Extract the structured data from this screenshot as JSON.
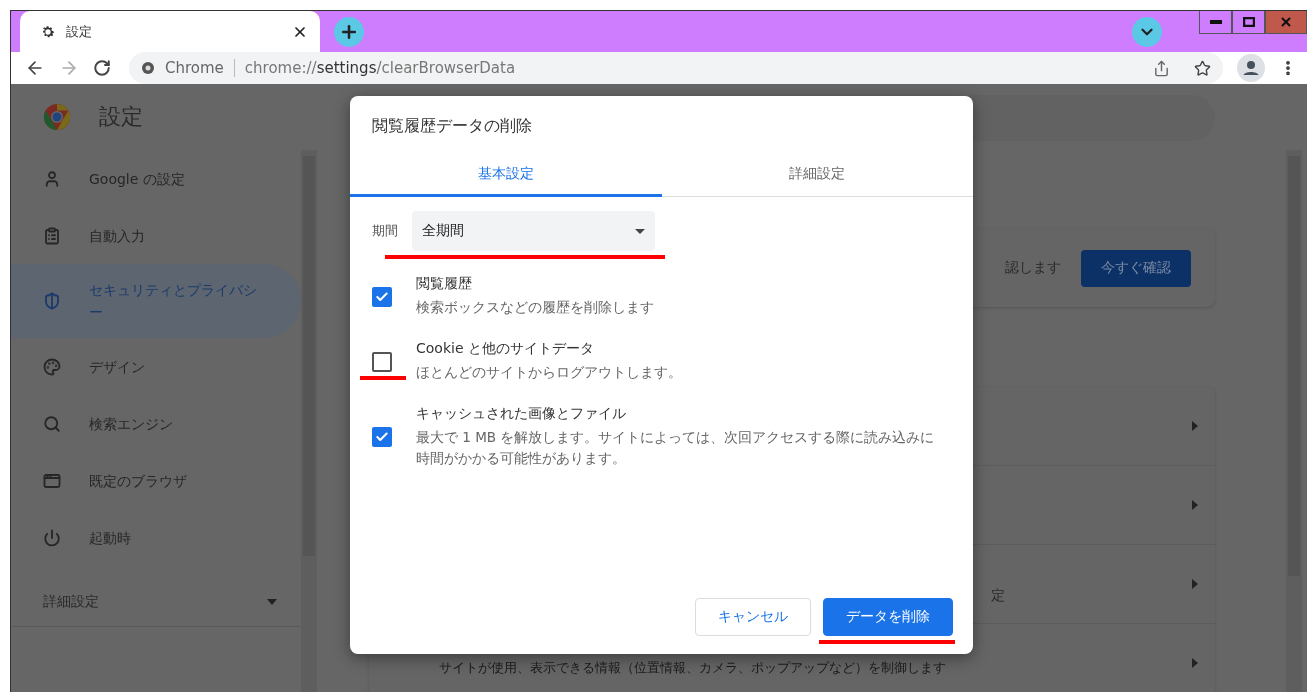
{
  "tab": {
    "title": "設定"
  },
  "address_bar": {
    "origin_label": "Chrome",
    "url_scheme": "chrome://",
    "url_host": "settings",
    "url_path": "/clearBrowserData"
  },
  "settings_header": {
    "title": "設定"
  },
  "sidebar": {
    "items": [
      {
        "kind": "person",
        "label": "Google の設定",
        "selected": false
      },
      {
        "kind": "clipboard",
        "label": "自動入力",
        "selected": false
      },
      {
        "kind": "shield",
        "label": "セキュリティとプライバシー",
        "selected": true
      },
      {
        "kind": "palette",
        "label": "デザイン",
        "selected": false
      },
      {
        "kind": "search",
        "label": "検索エンジン",
        "selected": false
      },
      {
        "kind": "browser",
        "label": "既定のブラウザ",
        "selected": false
      },
      {
        "kind": "power",
        "label": "起動時",
        "selected": false
      }
    ],
    "advanced": {
      "label": "詳細設定",
      "expanded": false
    }
  },
  "main": {
    "safety_card": {
      "text": "認します",
      "button": "今すぐ確認"
    },
    "rows": [
      {
        "kind": "plain"
      },
      {
        "kind": "plain"
      },
      {
        "kind": "label",
        "text": "定"
      },
      {
        "kind": "subtext",
        "text": "サイトが使用、表示できる情報（位置情報、カメラ、ポップアップなど）を制御します"
      }
    ]
  },
  "dialog": {
    "title": "閲覧履歴データの削除",
    "tabs": [
      {
        "label": "基本設定",
        "selected": true
      },
      {
        "label": "詳細設定",
        "selected": false
      }
    ],
    "time_range": {
      "label": "期間",
      "value": "全期間"
    },
    "options": [
      {
        "title": "閲覧履歴",
        "description": "検索ボックスなどの履歴を削除します",
        "checked": true
      },
      {
        "title": "Cookie と他のサイトデータ",
        "description": "ほとんどのサイトからログアウトします。",
        "checked": false
      },
      {
        "title": "キャッシュされた画像とファイル",
        "description": "最大で 1 MB を解放します。サイトによっては、次回アクセスする際に読み込みに時間がかかる可能性があります。",
        "checked": true
      }
    ],
    "buttons": [
      {
        "kind": "secondary",
        "label": "キャンセル"
      },
      {
        "kind": "primary",
        "label": "データを削除"
      }
    ]
  }
}
